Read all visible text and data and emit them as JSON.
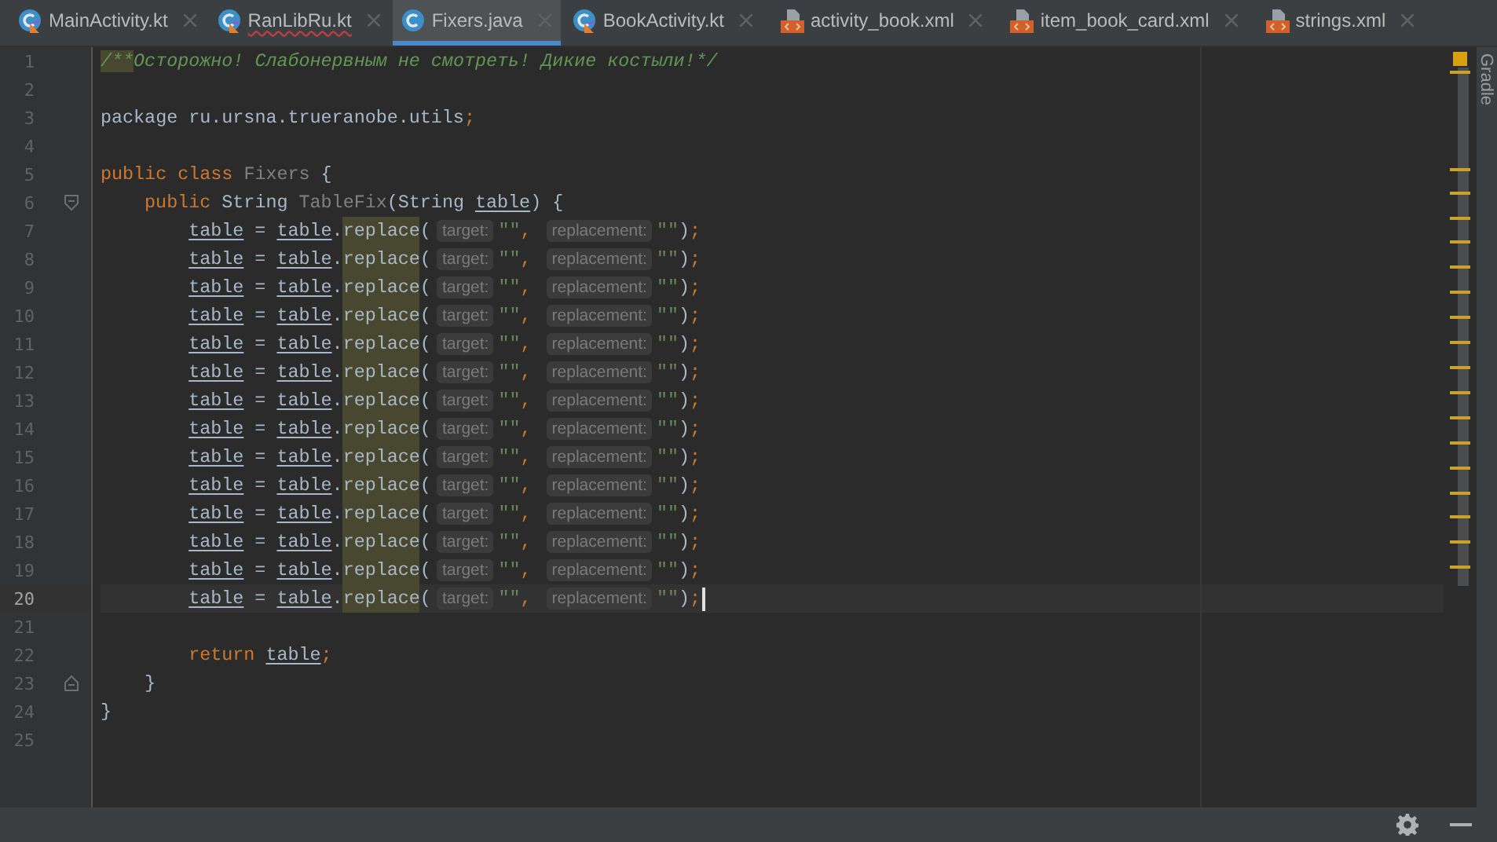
{
  "tabs": [
    {
      "label": "MainActivity.kt",
      "kind": "kotlin",
      "selected": false,
      "error": false
    },
    {
      "label": "RanLibRu.kt",
      "kind": "kotlin",
      "selected": false,
      "error": true
    },
    {
      "label": "Fixers.java",
      "kind": "java",
      "selected": true,
      "error": false
    },
    {
      "label": "BookActivity.kt",
      "kind": "kotlin",
      "selected": false,
      "error": false
    },
    {
      "label": "activity_book.xml",
      "kind": "xml",
      "selected": false,
      "error": false
    },
    {
      "label": "item_book_card.xml",
      "kind": "xml",
      "selected": false,
      "error": false
    },
    {
      "label": "strings.xml",
      "kind": "xml",
      "selected": false,
      "error": false
    }
  ],
  "side_panel": {
    "label": "Gradle"
  },
  "editor": {
    "lines": [
      {
        "number": "1",
        "tokens": [
          {
            "kind": "doc-mark",
            "text": "/**"
          },
          {
            "kind": "doc",
            "text": "Осторожно! Слабонервным не смотреть! Дикие костыли!*/"
          }
        ]
      },
      {
        "number": "2"
      },
      {
        "number": "3",
        "tokens": [
          {
            "kind": "plain",
            "text": "package ru.ursna.trueranobe.utils"
          },
          {
            "kind": "kw",
            "text": ";"
          }
        ]
      },
      {
        "number": "4"
      },
      {
        "number": "5",
        "tokens": [
          {
            "kind": "kw",
            "text": "public class "
          },
          {
            "kind": "unused",
            "text": "Fixers"
          },
          {
            "kind": "plain",
            "text": " {"
          }
        ],
        "children": [
          {
            "number": "6",
            "fold_start": true,
            "tokens": [
              {
                "kind": "kw",
                "text": "public "
              },
              {
                "kind": "plain",
                "text": "String "
              },
              {
                "kind": "unused",
                "text": "TableFix"
              },
              {
                "kind": "plain",
                "text": "(String "
              },
              {
                "kind": "param",
                "text": "table"
              },
              {
                "kind": "plain",
                "text": ") {"
              }
            ],
            "children": [
              {
                "number": "7",
                "tokens": [
                  {
                    "kind": "param",
                    "text": "table"
                  },
                  {
                    "kind": "plain",
                    "text": " = "
                  },
                  {
                    "kind": "param",
                    "text": "table"
                  },
                  {
                    "kind": "plain",
                    "text": "."
                  },
                  {
                    "kind": "call",
                    "text": "replace"
                  },
                  {
                    "kind": "plain",
                    "text": "("
                  },
                  {
                    "kind": "hint",
                    "text": "target:"
                  },
                  {
                    "kind": "string",
                    "text": "\"\""
                  },
                  {
                    "kind": "kw",
                    "text": ","
                  },
                  {
                    "kind": "hint",
                    "text": "replacement:"
                  },
                  {
                    "kind": "string",
                    "text": "\"\""
                  },
                  {
                    "kind": "plain",
                    "text": ")"
                  },
                  {
                    "kind": "kw",
                    "text": ";"
                  }
                ]
              },
              {
                "number": "8",
                "tokens": [
                  {
                    "kind": "param",
                    "text": "table"
                  },
                  {
                    "kind": "plain",
                    "text": " = "
                  },
                  {
                    "kind": "param",
                    "text": "table"
                  },
                  {
                    "kind": "plain",
                    "text": "."
                  },
                  {
                    "kind": "call",
                    "text": "replace"
                  },
                  {
                    "kind": "plain",
                    "text": "("
                  },
                  {
                    "kind": "hint",
                    "text": "target:"
                  },
                  {
                    "kind": "string",
                    "text": "\"\""
                  },
                  {
                    "kind": "kw",
                    "text": ","
                  },
                  {
                    "kind": "hint",
                    "text": "replacement:"
                  },
                  {
                    "kind": "string",
                    "text": "\"\""
                  },
                  {
                    "kind": "plain",
                    "text": ")"
                  },
                  {
                    "kind": "kw",
                    "text": ";"
                  }
                ]
              },
              {
                "number": "9",
                "tokens": [
                  {
                    "kind": "param",
                    "text": "table"
                  },
                  {
                    "kind": "plain",
                    "text": " = "
                  },
                  {
                    "kind": "param",
                    "text": "table"
                  },
                  {
                    "kind": "plain",
                    "text": "."
                  },
                  {
                    "kind": "call",
                    "text": "replace"
                  },
                  {
                    "kind": "plain",
                    "text": "("
                  },
                  {
                    "kind": "hint",
                    "text": "target:"
                  },
                  {
                    "kind": "string",
                    "text": "\"\""
                  },
                  {
                    "kind": "kw",
                    "text": ","
                  },
                  {
                    "kind": "hint",
                    "text": "replacement:"
                  },
                  {
                    "kind": "string",
                    "text": "\"\""
                  },
                  {
                    "kind": "plain",
                    "text": ")"
                  },
                  {
                    "kind": "kw",
                    "text": ";"
                  }
                ]
              },
              {
                "number": "10",
                "tokens": [
                  {
                    "kind": "param",
                    "text": "table"
                  },
                  {
                    "kind": "plain",
                    "text": " = "
                  },
                  {
                    "kind": "param",
                    "text": "table"
                  },
                  {
                    "kind": "plain",
                    "text": "."
                  },
                  {
                    "kind": "call",
                    "text": "replace"
                  },
                  {
                    "kind": "plain",
                    "text": "("
                  },
                  {
                    "kind": "hint",
                    "text": "target:"
                  },
                  {
                    "kind": "string",
                    "text": "\"\""
                  },
                  {
                    "kind": "kw",
                    "text": ","
                  },
                  {
                    "kind": "hint",
                    "text": "replacement:"
                  },
                  {
                    "kind": "string",
                    "text": "\"\""
                  },
                  {
                    "kind": "plain",
                    "text": ")"
                  },
                  {
                    "kind": "kw",
                    "text": ";"
                  }
                ]
              },
              {
                "number": "11",
                "tokens": [
                  {
                    "kind": "param",
                    "text": "table"
                  },
                  {
                    "kind": "plain",
                    "text": " = "
                  },
                  {
                    "kind": "param",
                    "text": "table"
                  },
                  {
                    "kind": "plain",
                    "text": "."
                  },
                  {
                    "kind": "call",
                    "text": "replace"
                  },
                  {
                    "kind": "plain",
                    "text": "("
                  },
                  {
                    "kind": "hint",
                    "text": "target:"
                  },
                  {
                    "kind": "string",
                    "text": "\"\""
                  },
                  {
                    "kind": "kw",
                    "text": ","
                  },
                  {
                    "kind": "hint",
                    "text": "replacement:"
                  },
                  {
                    "kind": "string",
                    "text": "\"\""
                  },
                  {
                    "kind": "plain",
                    "text": ")"
                  },
                  {
                    "kind": "kw",
                    "text": ";"
                  }
                ]
              },
              {
                "number": "12",
                "tokens": [
                  {
                    "kind": "param",
                    "text": "table"
                  },
                  {
                    "kind": "plain",
                    "text": " = "
                  },
                  {
                    "kind": "param",
                    "text": "table"
                  },
                  {
                    "kind": "plain",
                    "text": "."
                  },
                  {
                    "kind": "call",
                    "text": "replace"
                  },
                  {
                    "kind": "plain",
                    "text": "("
                  },
                  {
                    "kind": "hint",
                    "text": "target:"
                  },
                  {
                    "kind": "string",
                    "text": "\"\""
                  },
                  {
                    "kind": "kw",
                    "text": ","
                  },
                  {
                    "kind": "hint",
                    "text": "replacement:"
                  },
                  {
                    "kind": "string",
                    "text": "\"\""
                  },
                  {
                    "kind": "plain",
                    "text": ")"
                  },
                  {
                    "kind": "kw",
                    "text": ";"
                  }
                ]
              },
              {
                "number": "13",
                "tokens": [
                  {
                    "kind": "param",
                    "text": "table"
                  },
                  {
                    "kind": "plain",
                    "text": " = "
                  },
                  {
                    "kind": "param",
                    "text": "table"
                  },
                  {
                    "kind": "plain",
                    "text": "."
                  },
                  {
                    "kind": "call",
                    "text": "replace"
                  },
                  {
                    "kind": "plain",
                    "text": "("
                  },
                  {
                    "kind": "hint",
                    "text": "target:"
                  },
                  {
                    "kind": "string",
                    "text": "\"\""
                  },
                  {
                    "kind": "kw",
                    "text": ","
                  },
                  {
                    "kind": "hint",
                    "text": "replacement:"
                  },
                  {
                    "kind": "string",
                    "text": "\"\""
                  },
                  {
                    "kind": "plain",
                    "text": ")"
                  },
                  {
                    "kind": "kw",
                    "text": ";"
                  }
                ]
              },
              {
                "number": "14",
                "tokens": [
                  {
                    "kind": "param",
                    "text": "table"
                  },
                  {
                    "kind": "plain",
                    "text": " = "
                  },
                  {
                    "kind": "param",
                    "text": "table"
                  },
                  {
                    "kind": "plain",
                    "text": "."
                  },
                  {
                    "kind": "call",
                    "text": "replace"
                  },
                  {
                    "kind": "plain",
                    "text": "("
                  },
                  {
                    "kind": "hint",
                    "text": "target:"
                  },
                  {
                    "kind": "string",
                    "text": "\"\""
                  },
                  {
                    "kind": "kw",
                    "text": ","
                  },
                  {
                    "kind": "hint",
                    "text": "replacement:"
                  },
                  {
                    "kind": "string",
                    "text": "\"\""
                  },
                  {
                    "kind": "plain",
                    "text": ")"
                  },
                  {
                    "kind": "kw",
                    "text": ";"
                  }
                ]
              },
              {
                "number": "15",
                "tokens": [
                  {
                    "kind": "param",
                    "text": "table"
                  },
                  {
                    "kind": "plain",
                    "text": " = "
                  },
                  {
                    "kind": "param",
                    "text": "table"
                  },
                  {
                    "kind": "plain",
                    "text": "."
                  },
                  {
                    "kind": "call",
                    "text": "replace"
                  },
                  {
                    "kind": "plain",
                    "text": "("
                  },
                  {
                    "kind": "hint",
                    "text": "target:"
                  },
                  {
                    "kind": "string",
                    "text": "\"\""
                  },
                  {
                    "kind": "kw",
                    "text": ","
                  },
                  {
                    "kind": "hint",
                    "text": "replacement:"
                  },
                  {
                    "kind": "string",
                    "text": "\"\""
                  },
                  {
                    "kind": "plain",
                    "text": ")"
                  },
                  {
                    "kind": "kw",
                    "text": ";"
                  }
                ]
              },
              {
                "number": "16",
                "tokens": [
                  {
                    "kind": "param",
                    "text": "table"
                  },
                  {
                    "kind": "plain",
                    "text": " = "
                  },
                  {
                    "kind": "param",
                    "text": "table"
                  },
                  {
                    "kind": "plain",
                    "text": "."
                  },
                  {
                    "kind": "call",
                    "text": "replace"
                  },
                  {
                    "kind": "plain",
                    "text": "("
                  },
                  {
                    "kind": "hint",
                    "text": "target:"
                  },
                  {
                    "kind": "string",
                    "text": "\"\""
                  },
                  {
                    "kind": "kw",
                    "text": ","
                  },
                  {
                    "kind": "hint",
                    "text": "replacement:"
                  },
                  {
                    "kind": "string",
                    "text": "\"\""
                  },
                  {
                    "kind": "plain",
                    "text": ")"
                  },
                  {
                    "kind": "kw",
                    "text": ";"
                  }
                ]
              },
              {
                "number": "17",
                "tokens": [
                  {
                    "kind": "param",
                    "text": "table"
                  },
                  {
                    "kind": "plain",
                    "text": " = "
                  },
                  {
                    "kind": "param",
                    "text": "table"
                  },
                  {
                    "kind": "plain",
                    "text": "."
                  },
                  {
                    "kind": "call",
                    "text": "replace"
                  },
                  {
                    "kind": "plain",
                    "text": "("
                  },
                  {
                    "kind": "hint",
                    "text": "target:"
                  },
                  {
                    "kind": "string",
                    "text": "\"\""
                  },
                  {
                    "kind": "kw",
                    "text": ","
                  },
                  {
                    "kind": "hint",
                    "text": "replacement:"
                  },
                  {
                    "kind": "string",
                    "text": "\"\""
                  },
                  {
                    "kind": "plain",
                    "text": ")"
                  },
                  {
                    "kind": "kw",
                    "text": ";"
                  }
                ]
              },
              {
                "number": "18",
                "tokens": [
                  {
                    "kind": "param",
                    "text": "table"
                  },
                  {
                    "kind": "plain",
                    "text": " = "
                  },
                  {
                    "kind": "param",
                    "text": "table"
                  },
                  {
                    "kind": "plain",
                    "text": "."
                  },
                  {
                    "kind": "call",
                    "text": "replace"
                  },
                  {
                    "kind": "plain",
                    "text": "("
                  },
                  {
                    "kind": "hint",
                    "text": "target:"
                  },
                  {
                    "kind": "string",
                    "text": "\"\""
                  },
                  {
                    "kind": "kw",
                    "text": ","
                  },
                  {
                    "kind": "hint",
                    "text": "replacement:"
                  },
                  {
                    "kind": "string",
                    "text": "\"\""
                  },
                  {
                    "kind": "plain",
                    "text": ")"
                  },
                  {
                    "kind": "kw",
                    "text": ";"
                  }
                ]
              },
              {
                "number": "19",
                "tokens": [
                  {
                    "kind": "param",
                    "text": "table"
                  },
                  {
                    "kind": "plain",
                    "text": " = "
                  },
                  {
                    "kind": "param",
                    "text": "table"
                  },
                  {
                    "kind": "plain",
                    "text": "."
                  },
                  {
                    "kind": "call",
                    "text": "replace"
                  },
                  {
                    "kind": "plain",
                    "text": "("
                  },
                  {
                    "kind": "hint",
                    "text": "target:"
                  },
                  {
                    "kind": "string",
                    "text": "\"\""
                  },
                  {
                    "kind": "kw",
                    "text": ","
                  },
                  {
                    "kind": "hint",
                    "text": "replacement:"
                  },
                  {
                    "kind": "string",
                    "text": "\"\""
                  },
                  {
                    "kind": "plain",
                    "text": ")"
                  },
                  {
                    "kind": "kw",
                    "text": ";"
                  }
                ]
              },
              {
                "number": "20",
                "current": true,
                "tokens": [
                  {
                    "kind": "param",
                    "text": "table"
                  },
                  {
                    "kind": "plain",
                    "text": " = "
                  },
                  {
                    "kind": "param",
                    "text": "table"
                  },
                  {
                    "kind": "plain",
                    "text": "."
                  },
                  {
                    "kind": "call",
                    "text": "replace"
                  },
                  {
                    "kind": "plain",
                    "text": "("
                  },
                  {
                    "kind": "hint",
                    "text": "target:"
                  },
                  {
                    "kind": "string",
                    "text": "\"\""
                  },
                  {
                    "kind": "kw",
                    "text": ","
                  },
                  {
                    "kind": "hint",
                    "text": "replacement:"
                  },
                  {
                    "kind": "string",
                    "text": "\"\""
                  },
                  {
                    "kind": "plain",
                    "text": ")"
                  },
                  {
                    "kind": "kw",
                    "text": ";"
                  }
                ]
              },
              {
                "number": "21"
              },
              {
                "number": "22",
                "tokens": [
                  {
                    "kind": "kw",
                    "text": "return "
                  },
                  {
                    "kind": "param",
                    "text": "table"
                  },
                  {
                    "kind": "kw",
                    "text": ";"
                  }
                ]
              }
            ]
          },
          {
            "number": "23",
            "fold_end": true,
            "tokens": [
              {
                "kind": "plain",
                "text": "}"
              }
            ]
          }
        ]
      },
      {
        "number": "24",
        "tokens": [
          {
            "kind": "plain",
            "text": "}"
          }
        ]
      },
      {
        "number": "25"
      }
    ]
  }
}
